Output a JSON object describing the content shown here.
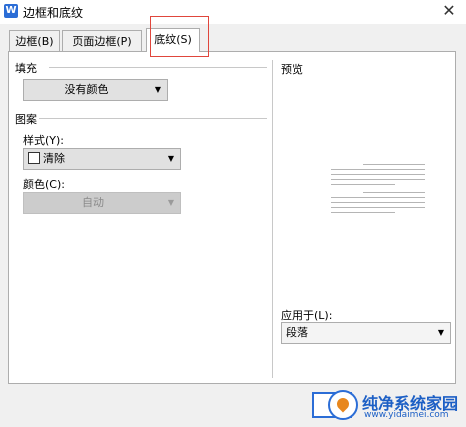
{
  "window": {
    "title": "边框和底纹",
    "close_glyph": "✕",
    "app_icon": "W"
  },
  "tabs": [
    {
      "label": "边框(B)"
    },
    {
      "label": "页面边框(P)"
    },
    {
      "label": "底纹(S)",
      "active": true
    }
  ],
  "fill": {
    "label": "填充",
    "value": "没有颜色"
  },
  "pattern": {
    "label": "图案",
    "style_label": "样式(Y):",
    "style_value": "清除",
    "color_label": "颜色(C):",
    "color_value": "自动"
  },
  "preview": {
    "label": "预览"
  },
  "apply_to": {
    "label": "应用于(L):",
    "value": "段落"
  },
  "watermark": {
    "text": "纯净系统家园",
    "url": "www.yidaimei.com"
  },
  "colors": {
    "accent": "#2b6dd6",
    "highlight": "#e0463c"
  }
}
